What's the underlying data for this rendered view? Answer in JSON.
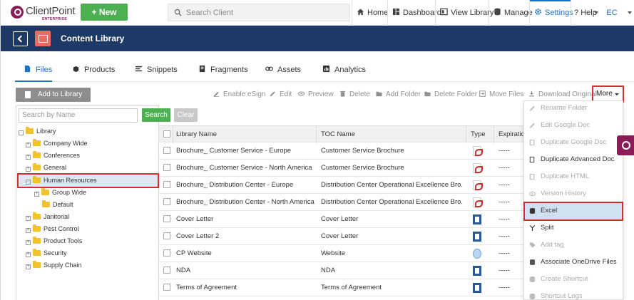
{
  "brand": {
    "name": "ClientPoint",
    "tier": "ENTERPRISE",
    "color": "#8a1d58"
  },
  "topnav": {
    "new_label": "+ New",
    "search_placeholder": "Search Client",
    "items": [
      {
        "label": "Home",
        "icon": "home-icon"
      },
      {
        "label": "Dashboard",
        "icon": "dashboard-icon"
      },
      {
        "label": "View Library",
        "icon": "library-icon"
      },
      {
        "label": "Manage",
        "icon": "manage-icon"
      },
      {
        "label": "Settings",
        "icon": "gear-icon",
        "active": true
      },
      {
        "label": "Help",
        "icon": "question-icon"
      }
    ],
    "user_initials": "EC"
  },
  "header": {
    "title": "Content Library",
    "bg": "#1d3a66"
  },
  "tabs": [
    {
      "label": "Files",
      "icon": "file-icon",
      "active": true
    },
    {
      "label": "Products",
      "icon": "products-icon"
    },
    {
      "label": "Snippets",
      "icon": "snippets-icon"
    },
    {
      "label": "Fragments",
      "icon": "fragments-icon"
    },
    {
      "label": "Assets",
      "icon": "link-icon"
    },
    {
      "label": "Analytics",
      "icon": "analytics-icon"
    }
  ],
  "toolbar": {
    "add_label": "Add to Library",
    "actions": [
      "Enable eSign",
      "Edit",
      "Preview",
      "Delete",
      "Add Folder",
      "Delete Folder",
      "Move Files",
      "Download Original"
    ],
    "more_label": "More"
  },
  "tree": {
    "search_placeholder": "Search by Name",
    "search_label": "Search",
    "clear_label": "Clear",
    "nodes": [
      {
        "label": "Library",
        "level": 0,
        "toggle": "-"
      },
      {
        "label": "Company Wide",
        "level": 1,
        "toggle": "+"
      },
      {
        "label": "Conferences",
        "level": 1,
        "toggle": "+"
      },
      {
        "label": "General",
        "level": 1,
        "toggle": "+"
      },
      {
        "label": "Human Resources",
        "level": 1,
        "toggle": "-",
        "selected": true
      },
      {
        "label": "Group Wide",
        "level": 2,
        "toggle": "+"
      },
      {
        "label": "Default",
        "level": 2,
        "toggle": ""
      },
      {
        "label": "Janitorial",
        "level": 1,
        "toggle": "+"
      },
      {
        "label": "Pest Control",
        "level": 1,
        "toggle": "+"
      },
      {
        "label": "Product Tools",
        "level": 1,
        "toggle": "+"
      },
      {
        "label": "Security",
        "level": 1,
        "toggle": "+"
      },
      {
        "label": "Supply Chain",
        "level": 1,
        "toggle": "+"
      }
    ]
  },
  "table": {
    "columns": [
      "Library Name",
      "TOC Name",
      "Type",
      "Expiration"
    ],
    "rows": [
      {
        "name": "Brochure_ Customer Service - Europe",
        "toc": "Customer Service Brochure",
        "type": "pdf",
        "exp": "-----"
      },
      {
        "name": "Brochure_ Customer Service - North America",
        "toc": "Customer Service Brochure",
        "type": "pdf",
        "exp": "-----"
      },
      {
        "name": "Brochure_ Distribution Center - Europe",
        "toc": "Distribution Center Operational Excellence Bro...",
        "type": "pdf",
        "exp": "-----"
      },
      {
        "name": "Brochure_ Distribution Center - North America",
        "toc": "Distribution Center Operational Excellence Bro...",
        "type": "pdf",
        "exp": "-----"
      },
      {
        "name": "Cover Letter",
        "toc": "Cover Letter",
        "type": "doc",
        "exp": "-----"
      },
      {
        "name": "Cover Letter 2",
        "toc": "Cover Letter",
        "type": "doc",
        "exp": "-----"
      },
      {
        "name": "CP Website",
        "toc": "Website",
        "type": "web",
        "exp": "-----"
      },
      {
        "name": "NDA",
        "toc": "NDA",
        "type": "doc",
        "exp": "-----"
      },
      {
        "name": "Terms of Agreement",
        "toc": "Terms of Agreement",
        "type": "doc",
        "exp": "-----"
      }
    ]
  },
  "more_menu": [
    {
      "label": "Rename Folder",
      "enabled": false,
      "icon": "pencil-icon"
    },
    {
      "label": "Edit Google Doc",
      "enabled": false,
      "icon": "pencil-icon"
    },
    {
      "label": "Duplicate Google Doc",
      "enabled": false,
      "icon": "copy-icon"
    },
    {
      "label": "Duplicate Advanced Doc",
      "enabled": true,
      "icon": "copy-icon"
    },
    {
      "label": "Duplicate HTML",
      "enabled": false,
      "icon": "copy-icon"
    },
    {
      "label": "Version History",
      "enabled": false,
      "icon": "eye-icon"
    },
    {
      "label": "Excel",
      "enabled": true,
      "highlighted": true,
      "icon": "database-icon"
    },
    {
      "label": "Split",
      "enabled": true,
      "icon": "split-icon"
    },
    {
      "label": "Add tag",
      "enabled": false,
      "icon": "tag-icon"
    },
    {
      "label": "Associate OneDrive Files",
      "enabled": true,
      "icon": "database-icon"
    },
    {
      "label": "Create Shortcut",
      "enabled": false,
      "icon": "database-icon"
    },
    {
      "label": "Shortcut Logs",
      "enabled": false,
      "icon": "database-icon"
    }
  ],
  "colors": {
    "accent": "#1a73c7",
    "success": "#4caf50",
    "highlight": "#d32f2f"
  }
}
